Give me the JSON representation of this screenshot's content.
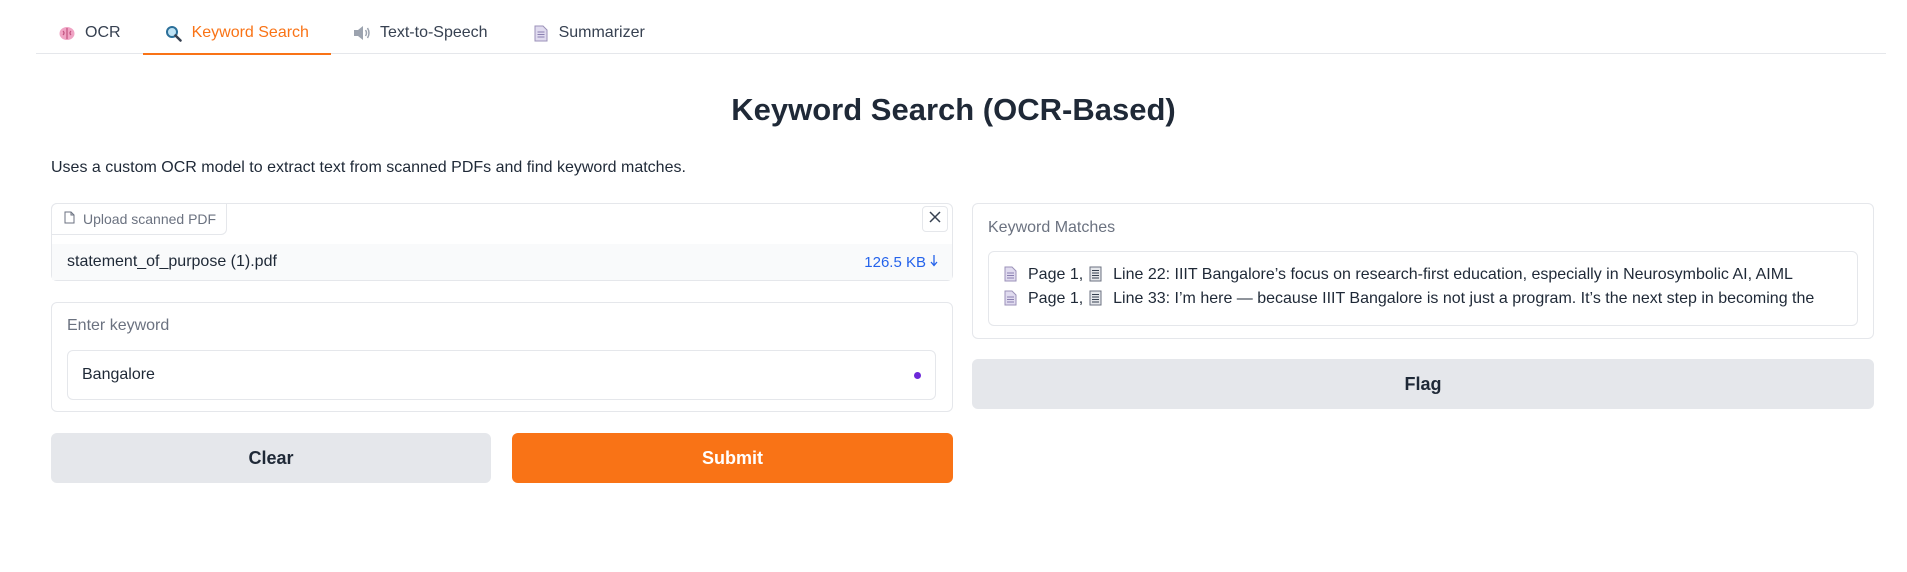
{
  "tabs": [
    {
      "label": "OCR",
      "icon": "brain-icon",
      "active": false
    },
    {
      "label": "Keyword Search",
      "icon": "magnifier-icon",
      "active": true
    },
    {
      "label": "Text-to-Speech",
      "icon": "speaker-icon",
      "active": false
    },
    {
      "label": "Summarizer",
      "icon": "document-icon",
      "active": false
    }
  ],
  "page": {
    "title": "Keyword Search (OCR-Based)",
    "description": "Uses a custom OCR model to extract text from scanned PDFs and find keyword matches."
  },
  "upload": {
    "label": "Upload scanned PDF",
    "file_name": "statement_of_purpose (1).pdf",
    "file_size": "126.5 KB"
  },
  "keyword": {
    "label": "Enter keyword",
    "value": "Bangalore"
  },
  "buttons": {
    "clear": "Clear",
    "submit": "Submit",
    "flag": "Flag"
  },
  "matches": {
    "label": "Keyword Matches",
    "lines": [
      {
        "page": "Page 1,",
        "text": "Line 22: IIIT Bangalore’s focus on research-first education, especially in Neurosymbolic AI, AIML"
      },
      {
        "page": "Page 1,",
        "text": "Line 33: I’m here — because IIIT Bangalore is not just a program. It’s the next step in becoming the"
      }
    ]
  },
  "colors": {
    "accent": "#f97316",
    "link": "#2563eb",
    "indicator": "#6d28d9"
  }
}
